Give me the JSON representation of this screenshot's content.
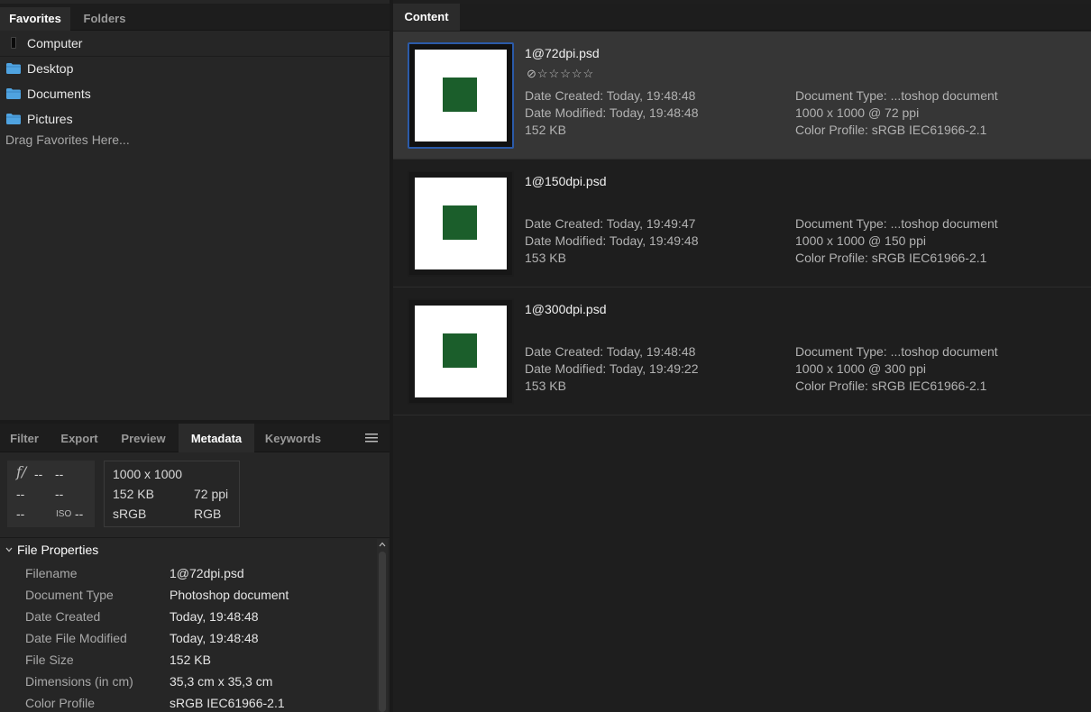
{
  "favorites_tabs": {
    "favorites": "Favorites",
    "folders": "Folders"
  },
  "favorites": {
    "items": [
      {
        "label": "Computer",
        "icon": "computer-icon"
      },
      {
        "label": "Desktop",
        "icon": "folder-icon"
      },
      {
        "label": "Documents",
        "icon": "folder-icon"
      },
      {
        "label": "Pictures",
        "icon": "folder-icon"
      }
    ],
    "drag_hint": "Drag Favorites Here...",
    "folder_color": "#4fa3e0"
  },
  "panel_tabs": {
    "filter": "Filter",
    "export": "Export",
    "preview": "Preview",
    "metadata": "Metadata",
    "keywords": "Keywords",
    "active": "Metadata"
  },
  "metadata": {
    "exif": {
      "aperture_icon": "f/",
      "aperture": "--",
      "shutter": "--",
      "r2c1": "--",
      "r2c2": "--",
      "r3c1": "--",
      "iso_label": "ISO",
      "iso": "--"
    },
    "summary": {
      "dimensions": "1000 x 1000",
      "size": "152 KB",
      "resolution": "72 ppi",
      "profile": "sRGB",
      "mode": "RGB"
    },
    "section_title": "File Properties",
    "properties": [
      {
        "key": "Filename",
        "value": "1@72dpi.psd"
      },
      {
        "key": "Document Type",
        "value": "Photoshop document"
      },
      {
        "key": "Date Created",
        "value": "Today, 19:48:48"
      },
      {
        "key": "Date File Modified",
        "value": "Today, 19:48:48"
      },
      {
        "key": "File Size",
        "value": "152 KB"
      },
      {
        "key": "Dimensions (in cm)",
        "value": "35,3 cm x 35,3 cm"
      },
      {
        "key": "Color Profile",
        "value": "sRGB IEC61966-2.1"
      }
    ]
  },
  "content": {
    "tab": "Content",
    "accent": "#2b5aa8",
    "thumb_square_color": "#1b5e2b",
    "items": [
      {
        "filename": "1@72dpi.psd",
        "rating": "⊘☆☆☆☆☆",
        "date_created": "Date Created: Today, 19:48:48",
        "date_modified": "Date Modified: Today, 19:48:48",
        "size": "152 KB",
        "doc_type": "Document Type: ...toshop document",
        "dims": "1000 x 1000 @ 72 ppi",
        "profile": "Color Profile: sRGB IEC61966-2.1",
        "selected": true
      },
      {
        "filename": "1@150dpi.psd",
        "rating": "",
        "date_created": "Date Created: Today, 19:49:47",
        "date_modified": "Date Modified: Today, 19:49:48",
        "size": "153 KB",
        "doc_type": "Document Type: ...toshop document",
        "dims": "1000 x 1000 @ 150 ppi",
        "profile": "Color Profile: sRGB IEC61966-2.1",
        "selected": false
      },
      {
        "filename": "1@300dpi.psd",
        "rating": "",
        "date_created": "Date Created: Today, 19:48:48",
        "date_modified": "Date Modified: Today, 19:49:22",
        "size": "153 KB",
        "doc_type": "Document Type: ...toshop document",
        "dims": "1000 x 1000 @ 300 ppi",
        "profile": "Color Profile: sRGB IEC61966-2.1",
        "selected": false
      }
    ]
  }
}
